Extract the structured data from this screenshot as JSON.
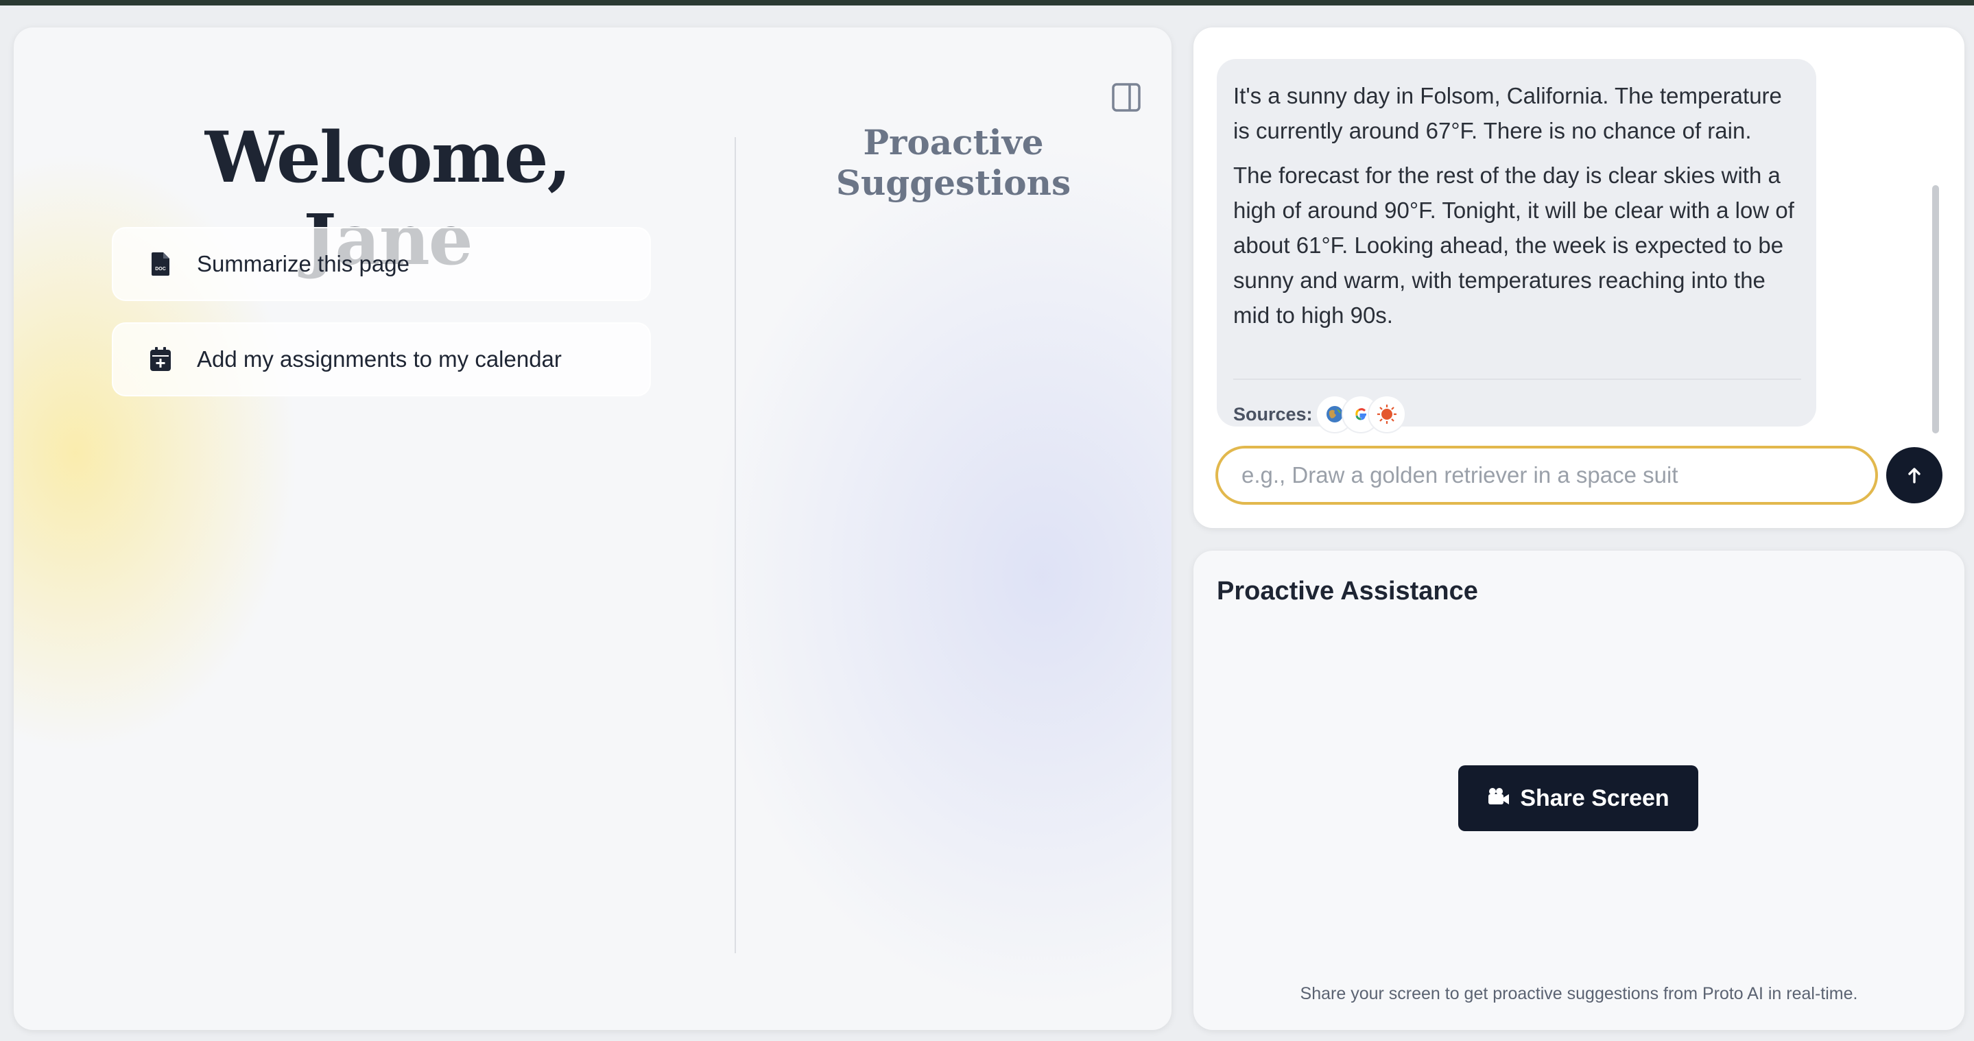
{
  "left_panel": {
    "welcome": "Welcome, Jane",
    "actions": [
      {
        "label": "Summarize this page",
        "icon": "document-icon"
      },
      {
        "label": "Add my assignments to my calendar",
        "icon": "calendar-add-icon"
      }
    ],
    "suggestions_title": "Proactive Suggestions",
    "toggle_icon": "sidebar-toggle-icon"
  },
  "chat": {
    "message_paragraphs": [
      "It's a sunny day in Folsom, California. The temperature is currently around 67°F. There is no chance of rain.",
      "The forecast for the rest of the day is clear skies with a high of around 90°F. Tonight, it will be clear with a low of about 61°F. Looking ahead, the week is expected to be sunny and warm, with temperatures reaching into the mid to high 90s."
    ],
    "sources_label": "Sources:",
    "source_icons": [
      "globe-icon",
      "google-icon",
      "orange-sun-icon"
    ],
    "input_placeholder": "e.g., Draw a golden retriever in a space suit",
    "input_value": ""
  },
  "assist": {
    "title": "Proactive Assistance",
    "share_button": "Share Screen",
    "hint": "Share your screen to get proactive suggestions from Proto AI in real-time."
  },
  "colors": {
    "accent_input_border": "#e2b84d",
    "dark_button": "#121a2b",
    "text_primary": "#1e2533"
  }
}
